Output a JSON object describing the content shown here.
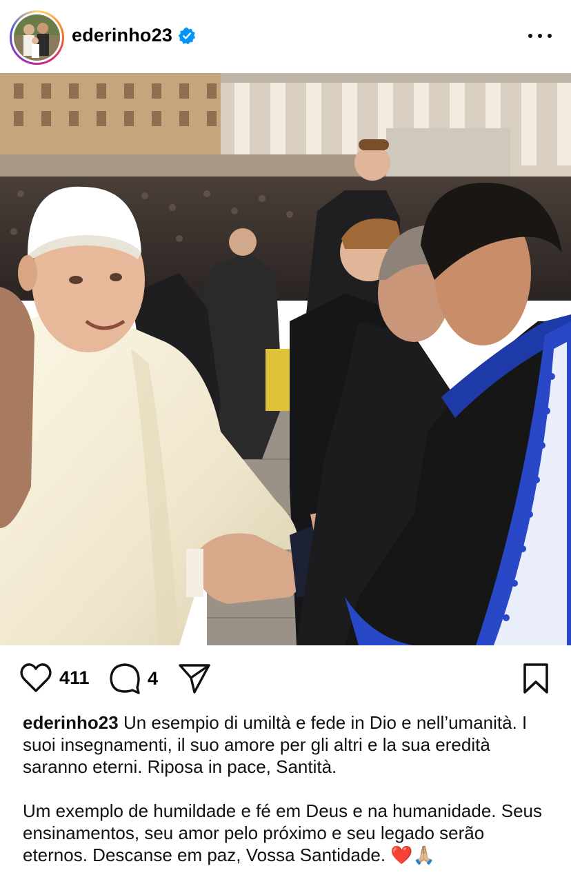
{
  "post": {
    "username": "ederinho23",
    "likes": "411",
    "comments": "4",
    "caption_it": "Un esempio di umiltà e fede in Dio e nell’umanità. I suoi insegnamenti, il suo amore per gli altri e la sua eredità saranno eterni. Riposa in pace, Santità.",
    "caption_pt": "Um exemplo de humildade e fé em Deus e na humanidade. Seus ensinamentos, seu amor pelo próximo e seu legado serão eternos. Descanse em paz, Vossa Santidade.",
    "caption_emoji": "❤️🙏🏼"
  },
  "icons": {
    "verified": "verified-badge-icon",
    "more": "more-options-icon",
    "like": "heart-icon",
    "comment": "comment-bubble-icon",
    "share": "paper-plane-icon",
    "save": "bookmark-icon"
  },
  "colors": {
    "verified": "#0095f6",
    "text": "#111111"
  }
}
